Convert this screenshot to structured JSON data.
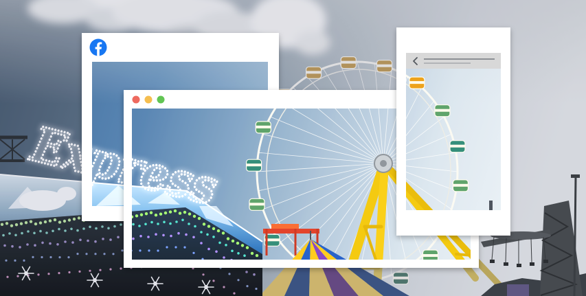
{
  "scene": {
    "sign_text": "Express"
  },
  "facebook_frame": {
    "icon": "facebook-icon",
    "brand_color": "#1877F2"
  },
  "browser_frame": {
    "window_control_colors": {
      "close": "#EE6A5F",
      "minimize": "#F5BE4F",
      "maximize": "#62C554"
    }
  },
  "mobile_frame": {
    "back_icon": "chevron-left-icon",
    "header_color": "#D8D8D8"
  }
}
